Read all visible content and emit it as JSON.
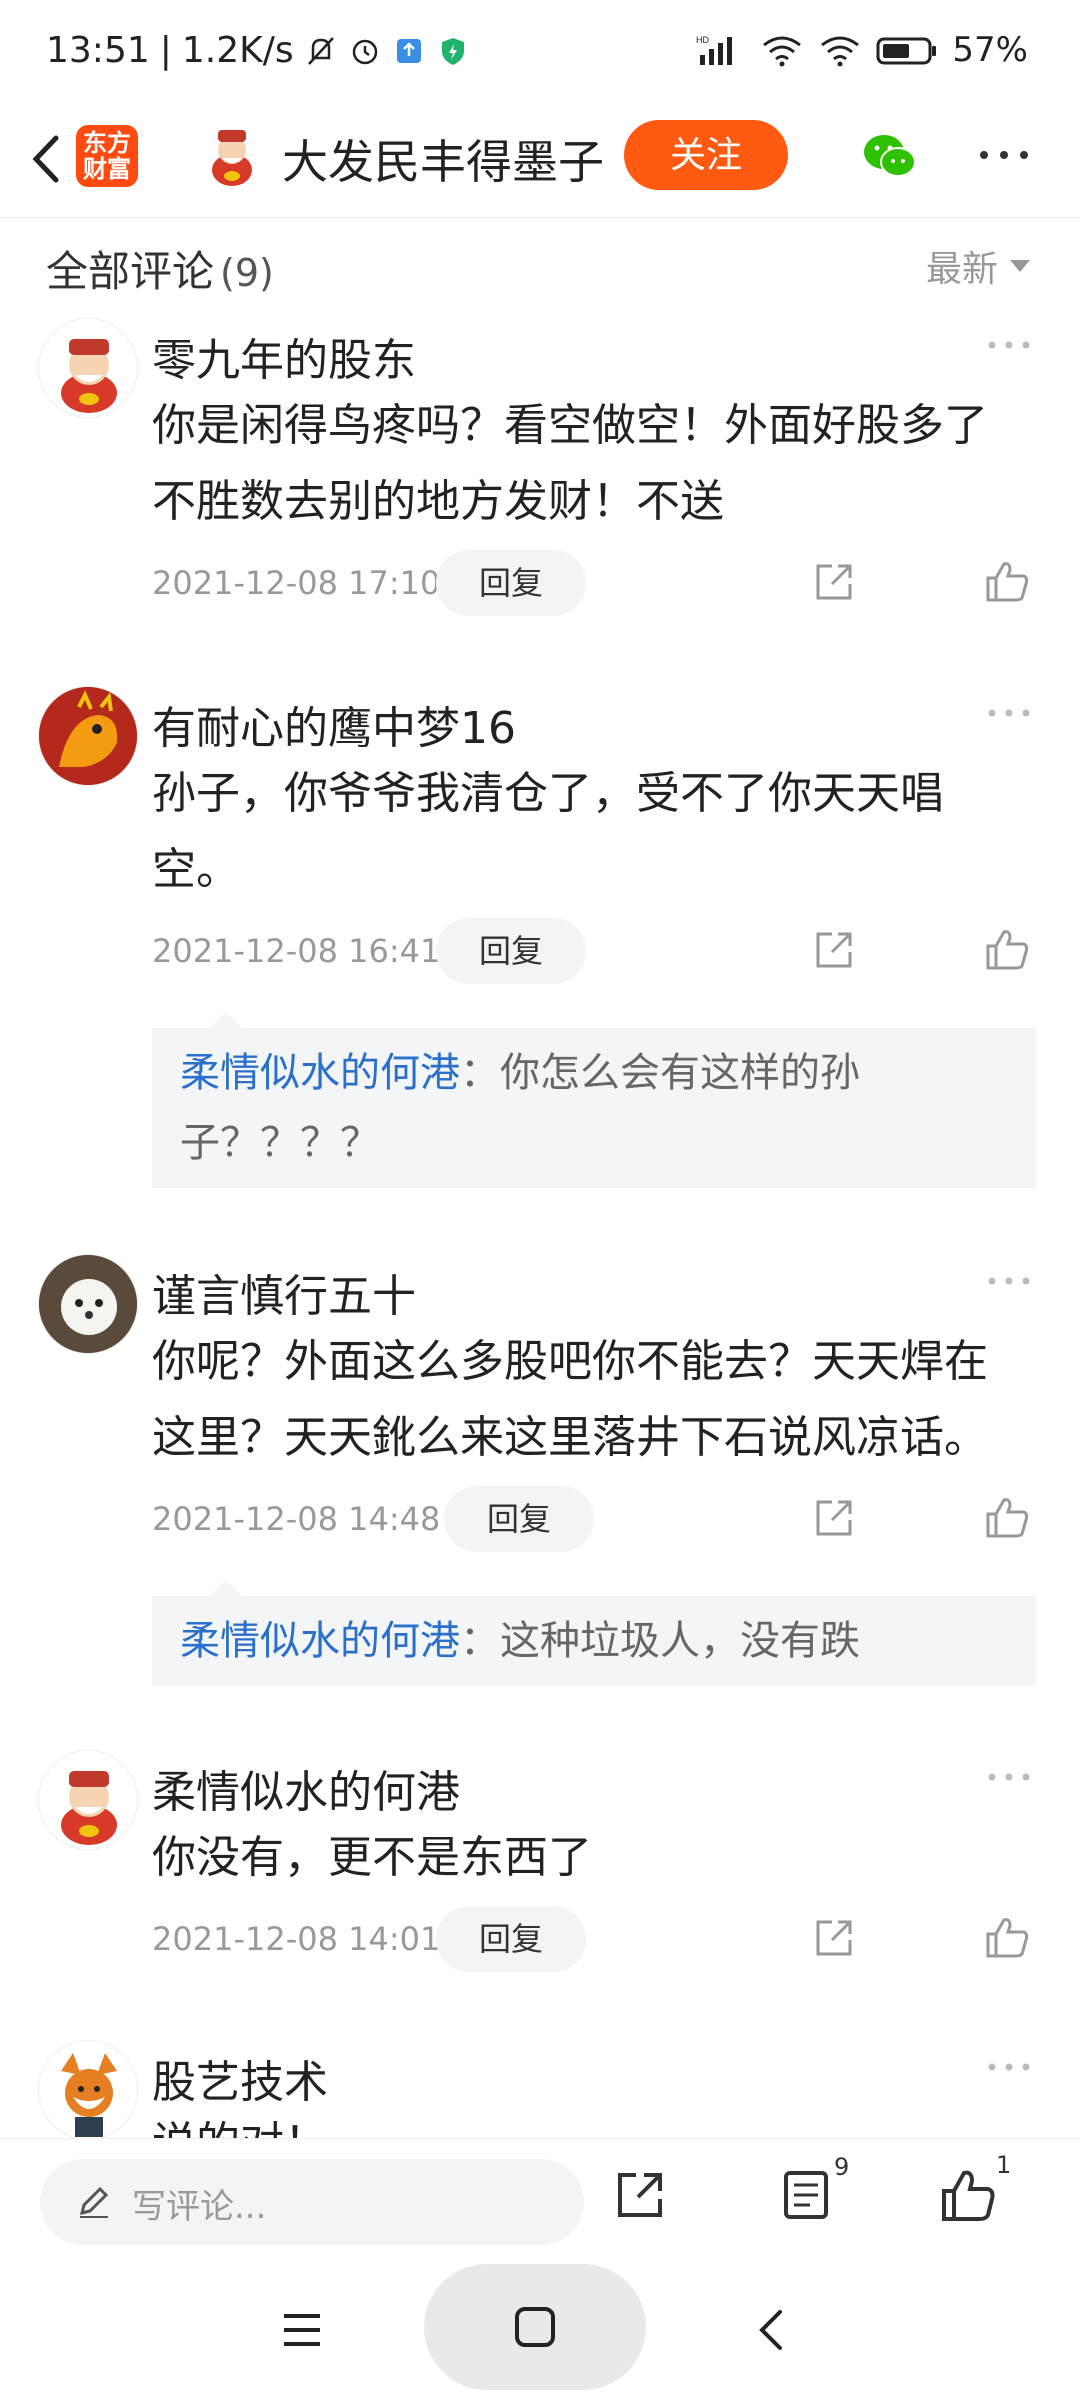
{
  "status": {
    "time": "13:51",
    "speed": "1.2K/s",
    "battery": "57%",
    "icons": [
      "mute-icon",
      "alarm-icon",
      "app-notify-icon",
      "shield-icon",
      "signal-icon",
      "wifi-icon",
      "battery-icon"
    ]
  },
  "nav": {
    "app_logo_line1": "东方",
    "app_logo_line2": "财富",
    "title": "大发民丰得墨子",
    "follow_label": "关注"
  },
  "comments_header": {
    "title": "全部评论",
    "count": "(9)",
    "sort_label": "最新"
  },
  "comments": [
    {
      "user": "零九年的股东",
      "line1": "你是闲得鸟疼吗？看空做空！外面好股多了",
      "line2": "不胜数去别的地方发财！不送",
      "time": "2021-12-08 17:10",
      "reply_label": "回复"
    },
    {
      "user": "有耐心的鹰中梦16",
      "line1": "孙子，你爷爷我清仓了，受不了你天天唱",
      "line2": "空。",
      "time": "2021-12-08 16:41",
      "reply_label": "回复",
      "quote": {
        "name": "柔情似水的何港",
        "line1": "：你怎么会有这样的孙",
        "line2": "子？？？？"
      }
    },
    {
      "user": "谨言慎行五十",
      "line1": "你呢？外面这么多股吧你不能去？天天焊在",
      "line2": "这里？天天鈋么来这里落井下石说风凉话。",
      "time": "2021-12-08 14:48",
      "reply_label": "回复",
      "quote": {
        "name": "柔情似水的何港",
        "line1": "：这种垃圾人，没有跌"
      }
    },
    {
      "user": "柔情似水的何港",
      "line1": "你没有，更不是东西了",
      "time": "2021-12-08 14:01",
      "reply_label": "回复"
    },
    {
      "user": "股艺技术",
      "line1": "说的对！"
    }
  ],
  "bottombar": {
    "input_placeholder": "写评论...",
    "comment_count": "9",
    "like_count": "1"
  },
  "colors": {
    "accent": "#ff5a12",
    "link": "#2a6fc9"
  }
}
